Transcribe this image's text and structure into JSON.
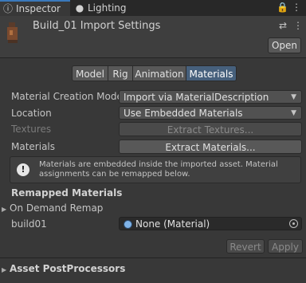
{
  "tabs": {
    "inspector": "Inspector",
    "lighting": "Lighting",
    "lock_icon": "lock-icon",
    "menu_icon": "kebab-menu-icon"
  },
  "header": {
    "title": "Build_01 Import Settings",
    "open_label": "Open",
    "settings_icon": "settings-sliders-icon",
    "menu_icon": "kebab-menu-icon"
  },
  "importer_tabs": [
    "Model",
    "Rig",
    "Animation",
    "Materials"
  ],
  "selected_tab": "Materials",
  "fields": {
    "material_creation_mode": {
      "label": "Material Creation Mode",
      "value": "Import via MaterialDescription"
    },
    "location": {
      "label": "Location",
      "value": "Use Embedded Materials"
    },
    "textures": {
      "label": "Textures",
      "button": "Extract Textures..."
    },
    "materials": {
      "label": "Materials",
      "button": "Extract Materials..."
    }
  },
  "help": {
    "text": "Materials are embedded inside the imported asset. Material assignments can be remapped below."
  },
  "remapped": {
    "heading": "Remapped Materials",
    "on_demand_remap": "On Demand Remap",
    "entry_label": "build01",
    "entry_value": "None (Material)"
  },
  "buttons": {
    "revert": "Revert",
    "apply": "Apply"
  },
  "footer": {
    "postprocessors": "Asset PostProcessors"
  },
  "colors": {
    "accent": "#3a79bb",
    "selected_tab": "#46607c",
    "background": "#383838"
  }
}
